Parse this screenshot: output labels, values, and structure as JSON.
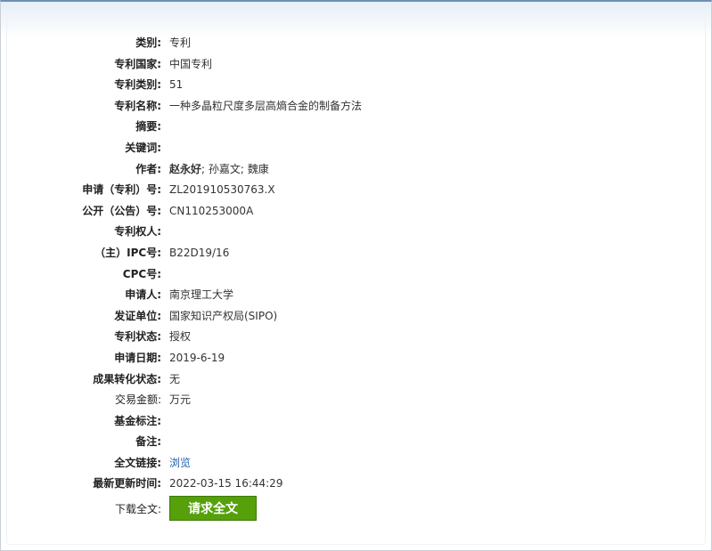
{
  "fields": [
    {
      "label": "类别:",
      "value": "专利",
      "bold": true
    },
    {
      "label": "专利国家:",
      "value": "中国专利",
      "bold": true
    },
    {
      "label": "专利类别:",
      "value": "51",
      "bold": true
    },
    {
      "label": "专利名称:",
      "value": "一种多晶粒尺度多层高熵合金的制备方法",
      "bold": true
    },
    {
      "label": "摘要:",
      "value": "",
      "bold": true
    },
    {
      "label": "关键词:",
      "value": "",
      "bold": true
    },
    {
      "label": "作者:",
      "value_bold": "赵永好",
      "value": "; 孙嘉文; 魏康",
      "bold": true
    },
    {
      "label": "申请（专利）号:",
      "value": "ZL201910530763.X",
      "bold": true
    },
    {
      "label": "公开（公告）号:",
      "value": "CN110253000A",
      "bold": true
    },
    {
      "label": "专利权人:",
      "value": "",
      "bold": true
    },
    {
      "label": "（主）IPC号:",
      "value": "B22D19/16",
      "bold": true
    },
    {
      "label": "CPC号:",
      "value": "",
      "bold": true
    },
    {
      "label": "申请人:",
      "value": "南京理工大学",
      "bold": true
    },
    {
      "label": "发证单位:",
      "value": "国家知识产权局(SIPO)",
      "bold": true
    },
    {
      "label": "专利状态:",
      "value": "授权",
      "bold": true
    },
    {
      "label": "申请日期:",
      "value": "2019-6-19",
      "bold": true
    },
    {
      "label": "成果转化状态:",
      "value": "无",
      "bold": true
    },
    {
      "label": "交易金额:",
      "value": "万元",
      "bold": false
    },
    {
      "label": "基金标注:",
      "value": "",
      "bold": true
    },
    {
      "label": "备注:",
      "value": "",
      "bold": true
    },
    {
      "label": "全文链接:",
      "value": "浏览",
      "bold": true,
      "link": true
    },
    {
      "label": "最新更新时间:",
      "value": "2022-03-15 16:44:29",
      "bold": true
    }
  ],
  "download": {
    "label": "下载全文:",
    "button_label": "请求全文"
  }
}
